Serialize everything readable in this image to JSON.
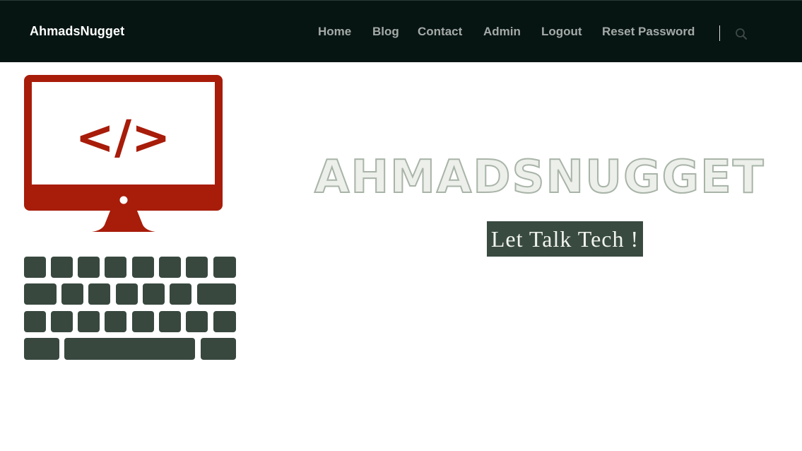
{
  "brand": {
    "name": "AhmadsNugget"
  },
  "nav": {
    "items": [
      {
        "label": "Home"
      },
      {
        "label": "Blog"
      },
      {
        "label": "Contact"
      },
      {
        "label": "Admin"
      },
      {
        "label": "Logout"
      },
      {
        "label": "Reset Password"
      }
    ],
    "search_icon": "search-icon"
  },
  "hero": {
    "logo_title": "AHMADSNUGGET",
    "tagline": "Let Talk Tech !",
    "illustration": {
      "code_symbol": "</>",
      "monitor_color": "#a81c0a",
      "keyboard_color": "#38483f"
    }
  },
  "colors": {
    "navbar_bg": "#061512",
    "nav_text": "#a5aaa8",
    "tagline_bg": "#394a41"
  }
}
